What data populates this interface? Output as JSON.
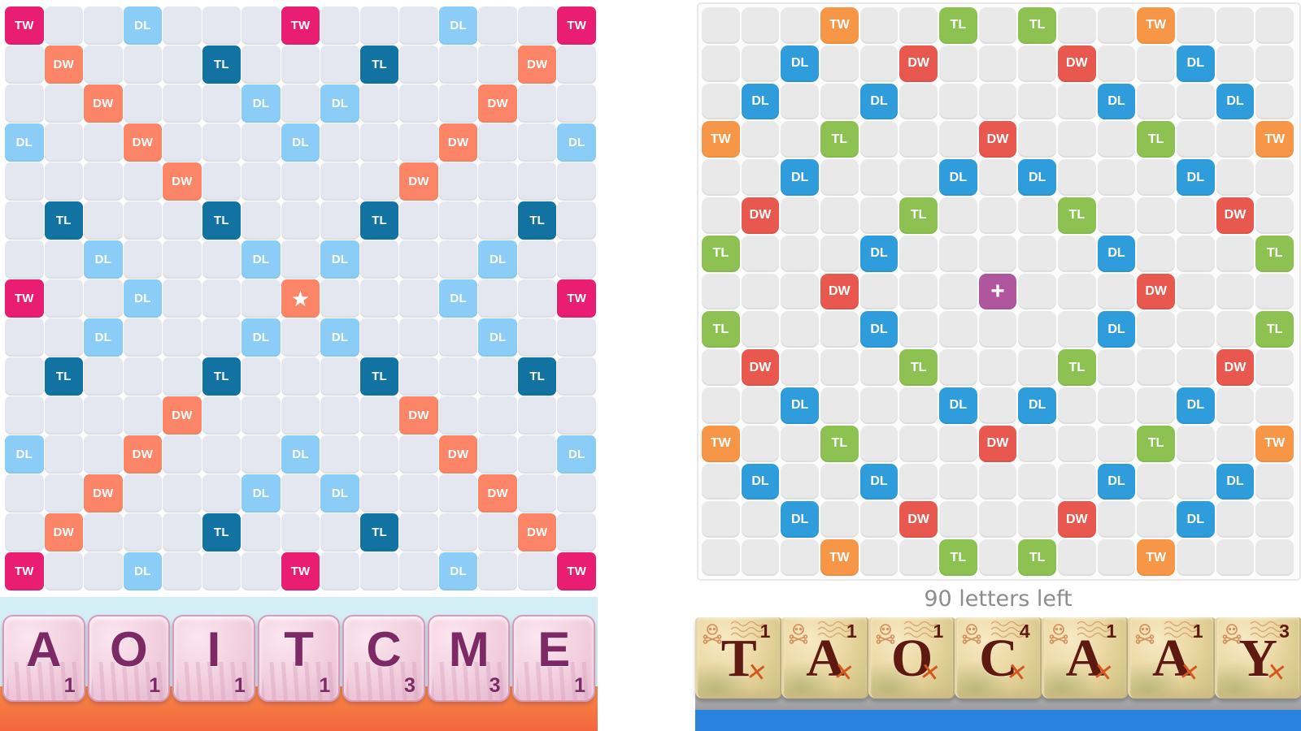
{
  "left_board": {
    "name": "Scrabble board",
    "size": 15,
    "legend": {
      "dl": "DL",
      "tl": "TL",
      "dw": "DW",
      "tw": "TW",
      "star": "★"
    },
    "colors": {
      "empty": "#e4e7ef",
      "dl": "#8ccdf7",
      "tl": "#1272a1",
      "dw": "#fd8567",
      "tw": "#e91e72",
      "star": "#fd8567"
    },
    "cells": [
      [
        "tw",
        "",
        "",
        "dl",
        "",
        "",
        "",
        "tw",
        "",
        "",
        "",
        "dl",
        "",
        "",
        "tw"
      ],
      [
        "",
        "dw",
        "",
        "",
        "",
        "tl",
        "",
        "",
        "",
        "tl",
        "",
        "",
        "",
        "dw",
        ""
      ],
      [
        "",
        "",
        "dw",
        "",
        "",
        "",
        "dl",
        "",
        "dl",
        "",
        "",
        "",
        "dw",
        "",
        ""
      ],
      [
        "dl",
        "",
        "",
        "dw",
        "",
        "",
        "",
        "dl",
        "",
        "",
        "",
        "dw",
        "",
        "",
        "dl"
      ],
      [
        "",
        "",
        "",
        "",
        "dw",
        "",
        "",
        "",
        "",
        "",
        "dw",
        "",
        "",
        "",
        ""
      ],
      [
        "",
        "tl",
        "",
        "",
        "",
        "tl",
        "",
        "",
        "",
        "tl",
        "",
        "",
        "",
        "tl",
        ""
      ],
      [
        "",
        "",
        "dl",
        "",
        "",
        "",
        "dl",
        "",
        "dl",
        "",
        "",
        "",
        "dl",
        "",
        ""
      ],
      [
        "tw",
        "",
        "",
        "dl",
        "",
        "",
        "",
        "star",
        "",
        "",
        "",
        "dl",
        "",
        "",
        "tw"
      ],
      [
        "",
        "",
        "dl",
        "",
        "",
        "",
        "dl",
        "",
        "dl",
        "",
        "",
        "",
        "dl",
        "",
        ""
      ],
      [
        "",
        "tl",
        "",
        "",
        "",
        "tl",
        "",
        "",
        "",
        "tl",
        "",
        "",
        "",
        "tl",
        ""
      ],
      [
        "",
        "",
        "",
        "",
        "dw",
        "",
        "",
        "",
        "",
        "",
        "dw",
        "",
        "",
        "",
        ""
      ],
      [
        "dl",
        "",
        "",
        "dw",
        "",
        "",
        "",
        "dl",
        "",
        "",
        "",
        "dw",
        "",
        "",
        "dl"
      ],
      [
        "",
        "",
        "dw",
        "",
        "",
        "",
        "dl",
        "",
        "dl",
        "",
        "",
        "",
        "dw",
        "",
        ""
      ],
      [
        "",
        "dw",
        "",
        "",
        "",
        "tl",
        "",
        "",
        "",
        "tl",
        "",
        "",
        "",
        "dw",
        ""
      ],
      [
        "tw",
        "",
        "",
        "dl",
        "",
        "",
        "",
        "tw",
        "",
        "",
        "",
        "dl",
        "",
        "",
        "tw"
      ]
    ]
  },
  "left_rack": {
    "name": "Player rack",
    "tiles": [
      {
        "letter": "A",
        "score": "1"
      },
      {
        "letter": "O",
        "score": "1"
      },
      {
        "letter": "I",
        "score": "1"
      },
      {
        "letter": "T",
        "score": "1"
      },
      {
        "letter": "C",
        "score": "3"
      },
      {
        "letter": "M",
        "score": "3"
      },
      {
        "letter": "E",
        "score": "1"
      }
    ]
  },
  "right_board": {
    "name": "Words With Friends board",
    "size": 15,
    "legend": {
      "dl": "DL",
      "tl": "TL",
      "dw": "DW",
      "tw": "TW",
      "start": "+"
    },
    "colors": {
      "empty": "#e9e9e9",
      "dl": "#2f9ddb",
      "tl": "#8dc252",
      "dw": "#e8584f",
      "tw": "#f79646",
      "start": "#b0569f"
    },
    "cells": [
      [
        "",
        "",
        "",
        "tw",
        "",
        "",
        "tl",
        "",
        "tl",
        "",
        "",
        "tw",
        "",
        "",
        ""
      ],
      [
        "",
        "",
        "dl",
        "",
        "",
        "dw",
        "",
        "",
        "",
        "dw",
        "",
        "",
        "dl",
        "",
        ""
      ],
      [
        "",
        "dl",
        "",
        "",
        "dl",
        "",
        "",
        "",
        "",
        "",
        "dl",
        "",
        "",
        "dl",
        ""
      ],
      [
        "tw",
        "",
        "",
        "tl",
        "",
        "",
        "",
        "dw",
        "",
        "",
        "",
        "tl",
        "",
        "",
        "tw"
      ],
      [
        "",
        "",
        "dl",
        "",
        "",
        "",
        "dl",
        "",
        "dl",
        "",
        "",
        "",
        "dl",
        "",
        ""
      ],
      [
        "",
        "dw",
        "",
        "",
        "",
        "tl",
        "",
        "",
        "",
        "tl",
        "",
        "",
        "",
        "dw",
        ""
      ],
      [
        "tl",
        "",
        "",
        "",
        "dl",
        "",
        "",
        "",
        "",
        "",
        "dl",
        "",
        "",
        "",
        "tl"
      ],
      [
        "",
        "",
        "",
        "dw",
        "",
        "",
        "",
        "start",
        "",
        "",
        "",
        "dw",
        "",
        "",
        ""
      ],
      [
        "tl",
        "",
        "",
        "",
        "dl",
        "",
        "",
        "",
        "",
        "",
        "dl",
        "",
        "",
        "",
        "tl"
      ],
      [
        "",
        "dw",
        "",
        "",
        "",
        "tl",
        "",
        "",
        "",
        "tl",
        "",
        "",
        "",
        "dw",
        ""
      ],
      [
        "",
        "",
        "dl",
        "",
        "",
        "",
        "dl",
        "",
        "dl",
        "",
        "",
        "",
        "dl",
        "",
        ""
      ],
      [
        "tw",
        "",
        "",
        "tl",
        "",
        "",
        "",
        "dw",
        "",
        "",
        "",
        "tl",
        "",
        "",
        "tw"
      ],
      [
        "",
        "dl",
        "",
        "",
        "dl",
        "",
        "",
        "",
        "",
        "",
        "dl",
        "",
        "",
        "dl",
        ""
      ],
      [
        "",
        "",
        "dl",
        "",
        "",
        "dw",
        "",
        "",
        "",
        "dw",
        "",
        "",
        "dl",
        "",
        ""
      ],
      [
        "",
        "",
        "",
        "tw",
        "",
        "",
        "tl",
        "",
        "tl",
        "",
        "",
        "tw",
        "",
        "",
        ""
      ]
    ]
  },
  "right_status": {
    "letters_left": "90 letters left"
  },
  "right_rack": {
    "name": "Player rack",
    "tiles": [
      {
        "letter": "T",
        "score": "1"
      },
      {
        "letter": "A",
        "score": "1"
      },
      {
        "letter": "O",
        "score": "1"
      },
      {
        "letter": "C",
        "score": "4"
      },
      {
        "letter": "A",
        "score": "1"
      },
      {
        "letter": "A",
        "score": "1"
      },
      {
        "letter": "Y",
        "score": "3"
      }
    ]
  }
}
